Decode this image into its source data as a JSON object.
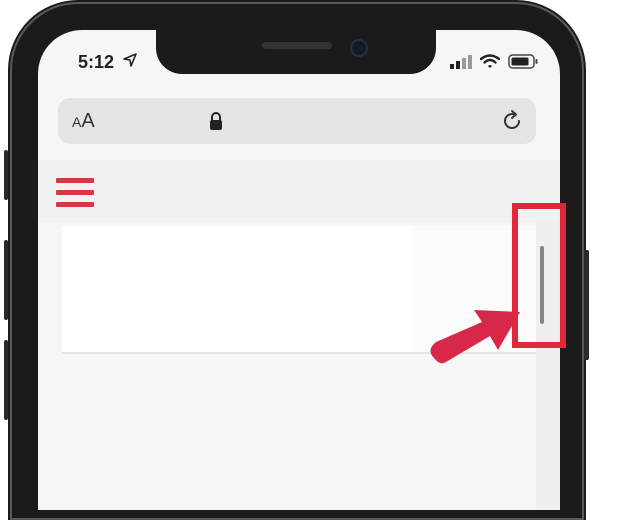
{
  "status_bar": {
    "time": "5:12",
    "location_icon": "location-arrow-icon",
    "signal_icon": "cellular-signal-icon",
    "wifi_icon": "wifi-icon",
    "battery_icon": "battery-icon"
  },
  "browser": {
    "text_size_label_small": "A",
    "text_size_label_large": "A",
    "lock_icon": "lock-icon",
    "reload_icon": "reload-icon"
  },
  "page": {
    "menu_icon": "hamburger-menu-icon",
    "menu_color": "#d43a3f"
  },
  "annotation": {
    "highlight_color": "#e0283a",
    "arrow_color": "#d8284a"
  }
}
